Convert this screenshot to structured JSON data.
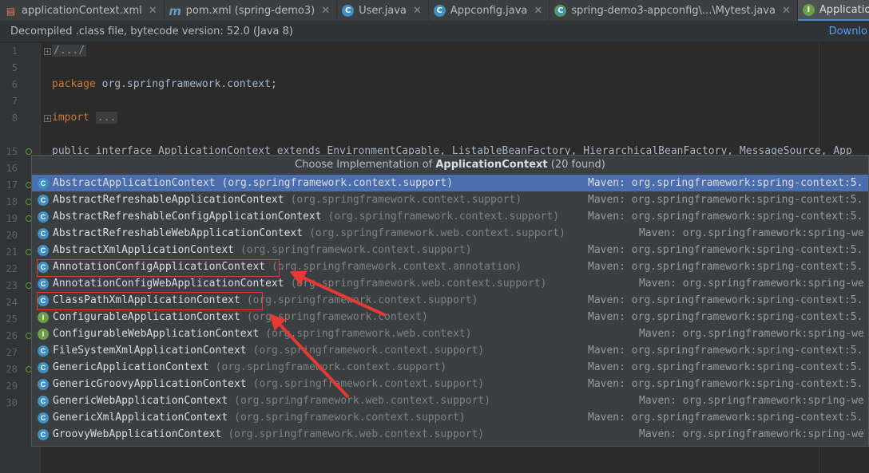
{
  "tabs": [
    {
      "label": "applicationContext.xml",
      "icon": "xml-file-icon",
      "active": false
    },
    {
      "label": "pom.xml (spring-demo3)",
      "icon": "maven-icon",
      "active": false
    },
    {
      "label": "User.java",
      "icon": "class-icon",
      "active": false
    },
    {
      "label": "Appconfig.java",
      "icon": "class-icon",
      "active": false
    },
    {
      "label": "spring-demo3-appconfig\\...\\Mytest.java",
      "icon": "test-class-icon",
      "active": false
    },
    {
      "label": "ApplicationContext.class",
      "icon": "interface-icon",
      "active": true
    }
  ],
  "infobar": {
    "message": "Decompiled .class file, bytecode version: 52.0 (Java 8)",
    "download_label": "Downlo"
  },
  "editor": {
    "line_numbers": [
      "1",
      "5",
      "6",
      "7",
      "8",
      "15",
      "16",
      "17",
      "18",
      "19",
      "20",
      "21",
      "22",
      "23",
      "24",
      "25",
      "26",
      "27",
      "28",
      "29",
      "30"
    ],
    "fold_header": "/.../",
    "package_keyword": "package",
    "package_name": "org.springframework.context;",
    "import_keyword": "import",
    "import_folded": "...",
    "decl_line": "public interface ApplicationContext extends EnvironmentCapable, ListableBeanFactory, HierarchicalBeanFactory, MessageSource, App"
  },
  "popup": {
    "title_prefix": "Choose Implementation of ",
    "title_target": "ApplicationContext",
    "title_suffix": " (20 found)",
    "items": [
      {
        "name": "AbstractApplicationContext",
        "package": "(org.springframework.context.support)",
        "source": "Maven: org.springframework:spring-context:5.",
        "kind": "C"
      },
      {
        "name": "AbstractRefreshableApplicationContext",
        "package": "(org.springframework.context.support)",
        "source": "Maven: org.springframework:spring-context:5.",
        "kind": "C"
      },
      {
        "name": "AbstractRefreshableConfigApplicationContext",
        "package": "(org.springframework.context.support)",
        "source": "Maven: org.springframework:spring-context:5.",
        "kind": "C"
      },
      {
        "name": "AbstractRefreshableWebApplicationContext",
        "package": "(org.springframework.web.context.support)",
        "source": "Maven: org.springframework:spring-we",
        "kind": "C"
      },
      {
        "name": "AbstractXmlApplicationContext",
        "package": "(org.springframework.context.support)",
        "source": "Maven: org.springframework:spring-context:5.",
        "kind": "C"
      },
      {
        "name": "AnnotationConfigApplicationContext",
        "package": "(org.springframework.context.annotation)",
        "source": "Maven: org.springframework:spring-context:5.",
        "kind": "C"
      },
      {
        "name": "AnnotationConfigWebApplicationContext",
        "package": "(org.springframework.web.context.support)",
        "source": "Maven: org.springframework:spring-we",
        "kind": "C"
      },
      {
        "name": "ClassPathXmlApplicationContext",
        "package": "(org.springframework.context.support)",
        "source": "Maven: org.springframework:spring-context:5.",
        "kind": "C"
      },
      {
        "name": "ConfigurableApplicationContext",
        "package": "(org.springframework.context)",
        "source": "Maven: org.springframework:spring-context:5.",
        "kind": "I"
      },
      {
        "name": "ConfigurableWebApplicationContext",
        "package": "(org.springframework.web.context)",
        "source": "Maven: org.springframework:spring-we",
        "kind": "I"
      },
      {
        "name": "FileSystemXmlApplicationContext",
        "package": "(org.springframework.context.support)",
        "source": "Maven: org.springframework:spring-context:5.",
        "kind": "C"
      },
      {
        "name": "GenericApplicationContext",
        "package": "(org.springframework.context.support)",
        "source": "Maven: org.springframework:spring-context:5.",
        "kind": "C"
      },
      {
        "name": "GenericGroovyApplicationContext",
        "package": "(org.springframework.context.support)",
        "source": "Maven: org.springframework:spring-context:5.",
        "kind": "C"
      },
      {
        "name": "GenericWebApplicationContext",
        "package": "(org.springframework.web.context.support)",
        "source": "Maven: org.springframework:spring-we",
        "kind": "C"
      },
      {
        "name": "GenericXmlApplicationContext",
        "package": "(org.springframework.context.support)",
        "source": "Maven: org.springframework:spring-context:5.",
        "kind": "C"
      },
      {
        "name": "GroovyWebApplicationContext",
        "package": "(org.springframework.web.context.support)",
        "source": "Maven: org.springframework:spring-we",
        "kind": "C"
      }
    ]
  },
  "colors": {
    "selection": "#4b6eaf",
    "annotation": "#e53935",
    "keyword": "#cc7832"
  }
}
